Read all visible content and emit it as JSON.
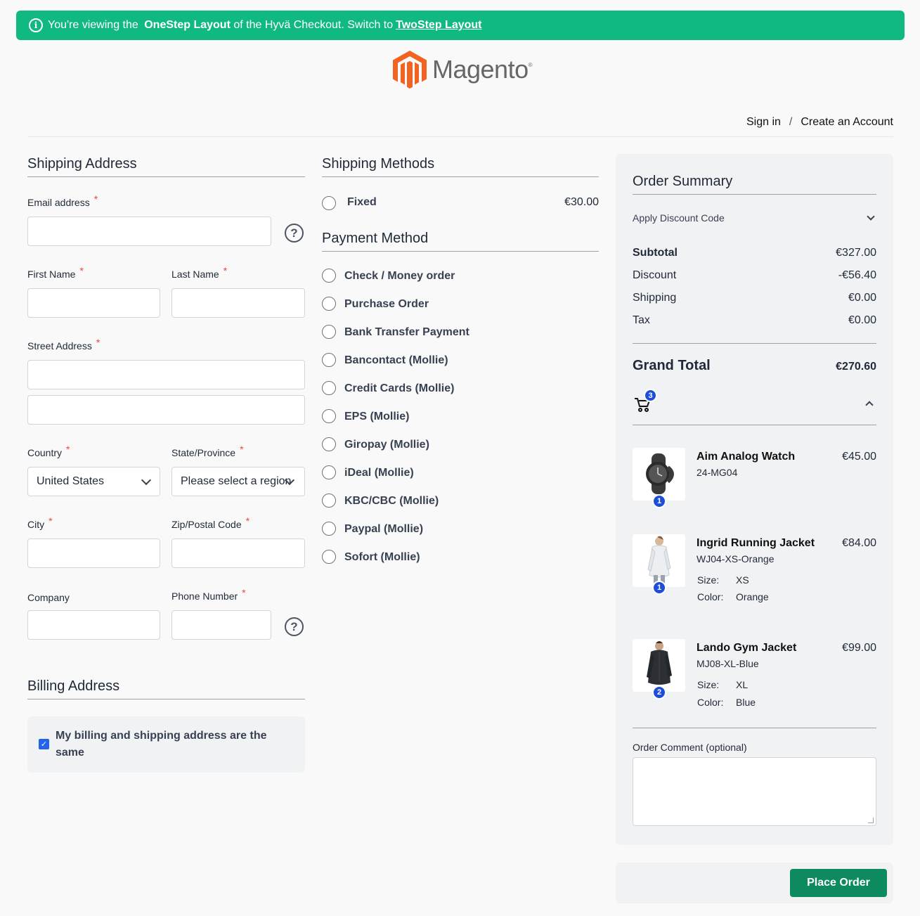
{
  "banner": {
    "prefix": "You're viewing the ",
    "layout_name": "OneStep Layout",
    "middle": " of the Hyvä Checkout. Switch to",
    "switch_link": "TwoStep Layout"
  },
  "logo": {
    "text": "Magento",
    "mark": "®"
  },
  "account": {
    "sign_in": "Sign in",
    "separator": "/",
    "create_account": "Create an Account"
  },
  "shipping_address": {
    "title": "Shipping Address",
    "email": {
      "label": "Email address",
      "value": ""
    },
    "first_name": {
      "label": "First Name",
      "value": ""
    },
    "last_name": {
      "label": "Last Name",
      "value": ""
    },
    "street": {
      "label": "Street Address",
      "line1": "",
      "line2": ""
    },
    "country": {
      "label": "Country",
      "value": "United States"
    },
    "region": {
      "label": "State/Province",
      "value": "Please select a region"
    },
    "city": {
      "label": "City",
      "value": ""
    },
    "zip": {
      "label": "Zip/Postal Code",
      "value": ""
    },
    "company": {
      "label": "Company",
      "value": ""
    },
    "phone": {
      "label": "Phone Number",
      "value": ""
    },
    "required_mark": "*"
  },
  "billing_address": {
    "title": "Billing Address",
    "same_as_shipping_label": "My billing and shipping address are the same",
    "same_as_shipping_checked": true
  },
  "shipping_methods": {
    "title": "Shipping Methods",
    "options": [
      {
        "label": "Fixed",
        "price": "€30.00"
      }
    ]
  },
  "payment_method": {
    "title": "Payment Method",
    "options": [
      "Check / Money order",
      "Purchase Order",
      "Bank Transfer Payment",
      "Bancontact (Mollie)",
      "Credit Cards (Mollie)",
      "EPS (Mollie)",
      "Giropay (Mollie)",
      "iDeal (Mollie)",
      "KBC/CBC (Mollie)",
      "Paypal (Mollie)",
      "Sofort (Mollie)"
    ]
  },
  "order_summary": {
    "title": "Order Summary",
    "discount_toggle": "Apply Discount Code",
    "subtotal": {
      "label": "Subtotal",
      "value": "€327.00"
    },
    "discount": {
      "label": "Discount",
      "value": "-€56.40"
    },
    "shipping": {
      "label": "Shipping",
      "value": "€0.00"
    },
    "tax": {
      "label": "Tax",
      "value": "€0.00"
    },
    "grand_total": {
      "label": "Grand Total",
      "value": "€270.60"
    },
    "cart_count": "3",
    "items": [
      {
        "name": "Aim Analog Watch",
        "sku": "24-MG04",
        "price": "€45.00",
        "qty": "1"
      },
      {
        "name": "Ingrid Running Jacket",
        "sku": "WJ04-XS-Orange",
        "price": "€84.00",
        "qty": "1",
        "options": [
          {
            "label": "Size:",
            "value": "XS"
          },
          {
            "label": "Color:",
            "value": "Orange"
          }
        ]
      },
      {
        "name": "Lando Gym Jacket",
        "sku": "MJ08-XL-Blue",
        "price": "€99.00",
        "qty": "2",
        "options": [
          {
            "label": "Size:",
            "value": "XL"
          },
          {
            "label": "Color:",
            "value": "Blue"
          }
        ]
      }
    ],
    "comment_label": "Order Comment (optional)",
    "comment_value": ""
  },
  "place_order": {
    "label": "Place Order"
  },
  "colors": {
    "banner": "#10b981",
    "place_order": "#0e8a5f",
    "badge": "#1d4ed8",
    "required": "#ef4444",
    "logo_orange": "#f26322"
  }
}
